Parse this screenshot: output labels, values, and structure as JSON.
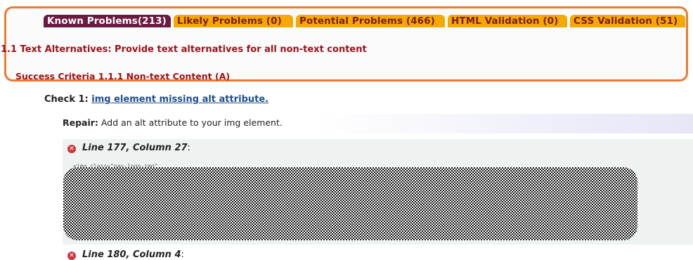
{
  "tabs": [
    {
      "label": "Known Problems(213)",
      "active": true
    },
    {
      "label": "Likely Problems (0)",
      "active": false
    },
    {
      "label": "Potential Problems (466)",
      "active": false
    },
    {
      "label": "HTML Validation (0)",
      "active": false
    },
    {
      "label": "CSS Validation (51)",
      "active": false
    }
  ],
  "guideline": {
    "title": "1.1 Text Alternatives: Provide text alternatives for all non-text content"
  },
  "criteria": {
    "title": "Success Criteria 1.1.1 Non-text Content (A)"
  },
  "check": {
    "prefix": "Check 1:",
    "link": "img element missing alt attribute."
  },
  "repair": {
    "prefix": "Repair:",
    "text": "Add an alt attribute to your img element."
  },
  "errors": [
    {
      "location": "Line 177, Column 27",
      "snippet": "<img class=\"nav-logo-img\""
    },
    {
      "location": "Line 180, Column 4"
    }
  ],
  "colors": {
    "highlight": "#ee7a2e",
    "active_tab": "#6b1a3f",
    "inactive_tab": "#f5a800",
    "heading_red": "#a01018",
    "link_blue": "#1f4e8c",
    "error_icon": "#d2343b"
  },
  "icons": {
    "error": "error-x-circle-icon"
  }
}
